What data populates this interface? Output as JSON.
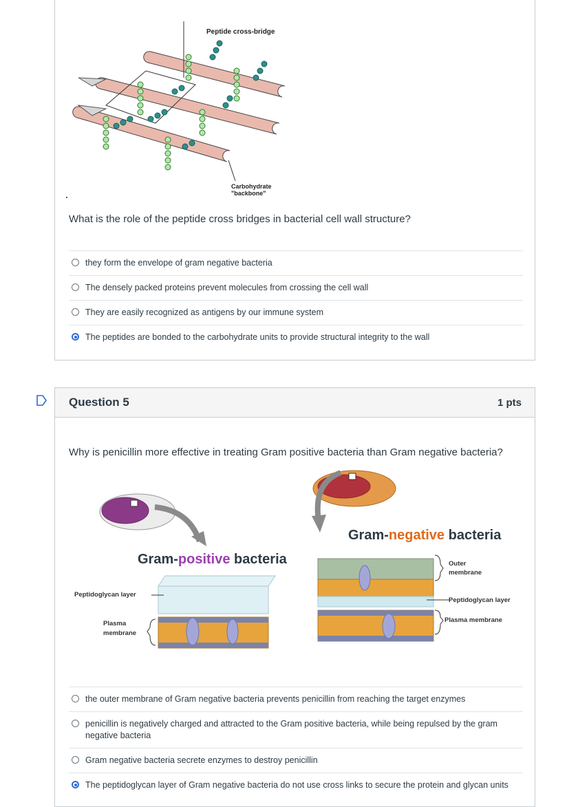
{
  "question4": {
    "figure": {
      "label_cross_bridge": "Peptide cross-bridge",
      "label_backbone_line1": "Carbohydrate",
      "label_backbone_line2": "\"backbone\""
    },
    "question_text": "What is the role of the peptide cross bridges in bacterial cell wall structure?",
    "answers": [
      {
        "text": "they form the envelope of gram negative bacteria",
        "selected": false
      },
      {
        "text": "The densely packed proteins prevent molecules from crossing the cell wall",
        "selected": false
      },
      {
        "text": "They are easily recognized as antigens by our immune system",
        "selected": false
      },
      {
        "text": "The peptides are bonded to the carbohydrate units to provide structural integrity to the wall",
        "selected": true
      }
    ]
  },
  "question5": {
    "title": "Question 5",
    "points": "1 pts",
    "question_text": "Why is penicillin more effective in treating Gram positive bacteria than Gram negative bacteria?",
    "figure": {
      "gram_negative": {
        "prefix": "Gram-",
        "highlight": "negative",
        "suffix": " bacteria"
      },
      "gram_positive": {
        "prefix": "Gram-",
        "highlight": "positive",
        "suffix": " bacteria"
      },
      "peptidoglycan_layer_left": "Peptidoglycan layer",
      "plasma_membrane_left_1": "Plasma",
      "plasma_membrane_left_2": "membrane",
      "outer_membrane_1": "Outer",
      "outer_membrane_2": "membrane",
      "peptidoglycan_layer_right": "Peptidoglycan  layer",
      "plasma_membrane_right": "Plasma membrane"
    },
    "answers": [
      {
        "text": "the outer membrane of Gram negative bacteria prevents penicillin from reaching the target enzymes",
        "selected": false
      },
      {
        "text": "penicillin is negatively charged and attracted to the Gram positive bacteria, while being repulsed by the gram negative bacteria",
        "selected": false
      },
      {
        "text": "Gram negative bacteria secrete enzymes to destroy penicillin",
        "selected": false
      },
      {
        "text": "The peptidoglycan layer of Gram negative bacteria do not use cross links to secure the protein and glycan units",
        "selected": true
      }
    ]
  },
  "colors": {
    "accent_blue": "#2b6cd6",
    "highlight_purple": "#9b3fb0",
    "text": "#2d3b45",
    "border": "#c7cdd1"
  }
}
